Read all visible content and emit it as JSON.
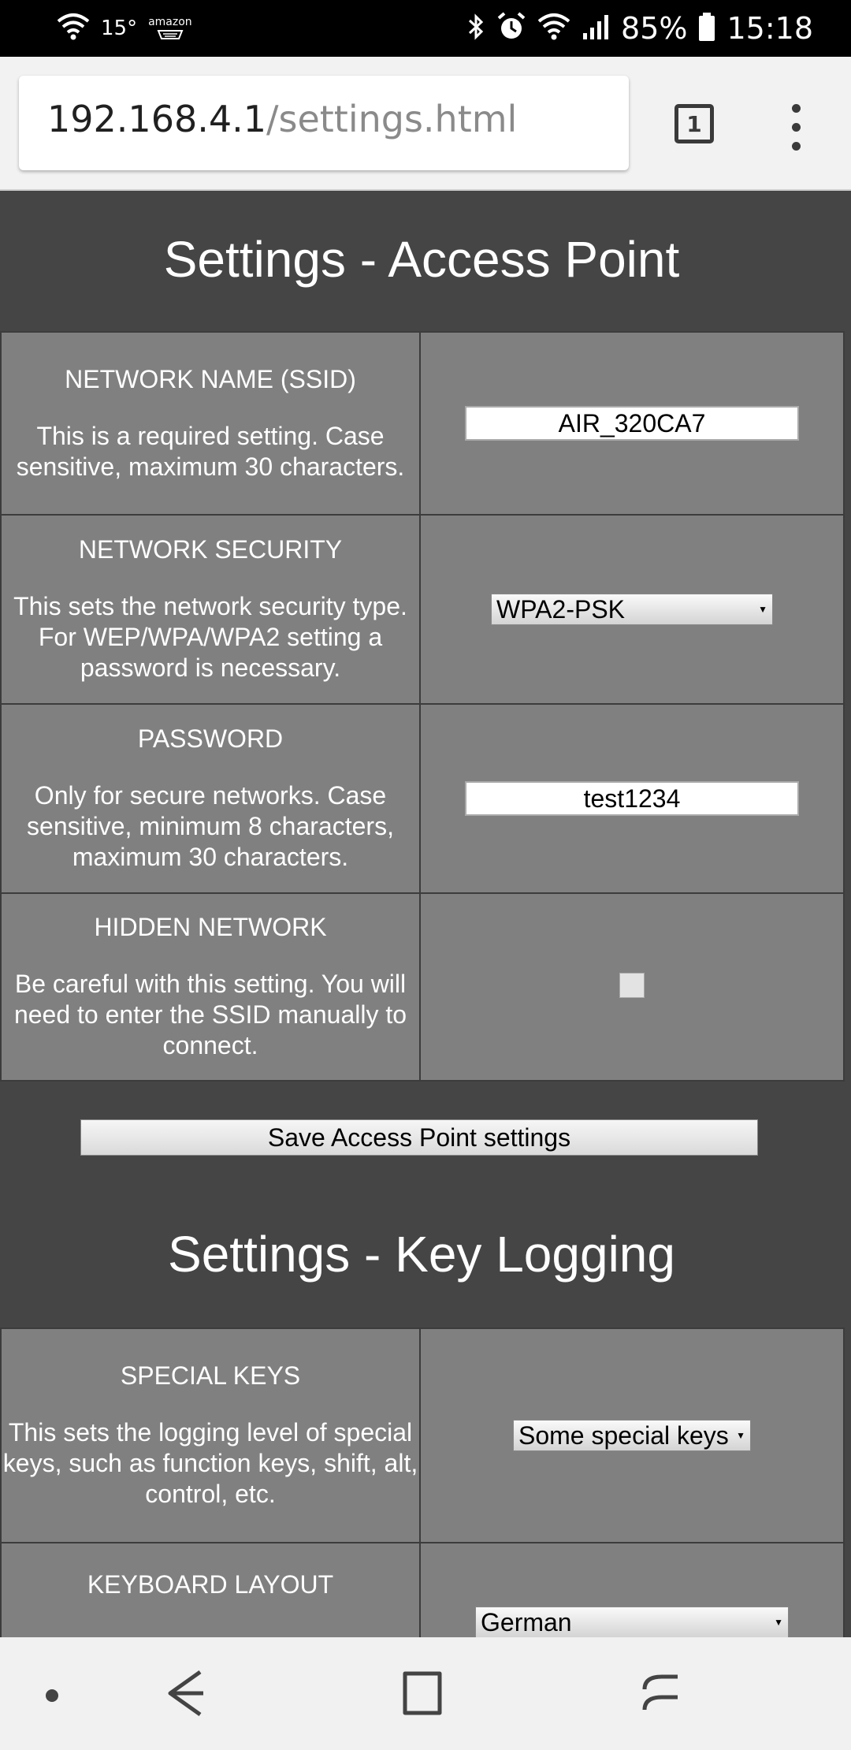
{
  "status_bar": {
    "temperature": "15°",
    "amazon_label": "amazon",
    "battery": "85%",
    "time": "15:18"
  },
  "browser": {
    "url_host": "192.168.4.1",
    "url_path": "/settings.html",
    "tab_count": "1"
  },
  "access_point": {
    "title": "Settings - Access Point",
    "ssid": {
      "label": "NETWORK NAME (SSID)",
      "help": "This is a required setting. Case sensitive, maximum 30 characters.",
      "value": "AIR_320CA7"
    },
    "security": {
      "label": "NETWORK SECURITY",
      "help": "This sets the network security type. For WEP/WPA/WPA2 setting a password is necessary.",
      "value": "WPA2-PSK"
    },
    "password": {
      "label": "PASSWORD",
      "help": "Only for secure networks. Case sensitive, minimum 8 characters, maximum 30 characters.",
      "value": "test1234"
    },
    "hidden": {
      "label": "HIDDEN NETWORK",
      "help": "Be careful with this setting. You will need to enter the SSID manually to connect.",
      "checked": false
    },
    "save_label": "Save Access Point settings"
  },
  "key_logging": {
    "title": "Settings - Key Logging",
    "special_keys": {
      "label": "SPECIAL KEYS",
      "help": "This sets the logging level of special keys, such as function keys, shift, alt, control, etc.",
      "value": "Some special keys"
    },
    "keyboard_layout": {
      "label": "KEYBOARD LAYOUT",
      "value": "German"
    }
  },
  "icons": [
    "wifi-icon",
    "amazon-icon",
    "bluetooth-icon",
    "alarm-icon",
    "signal-icon",
    "battery-icon",
    "tabs-icon",
    "more-menu-icon",
    "back-icon",
    "home-icon",
    "recents-icon"
  ]
}
